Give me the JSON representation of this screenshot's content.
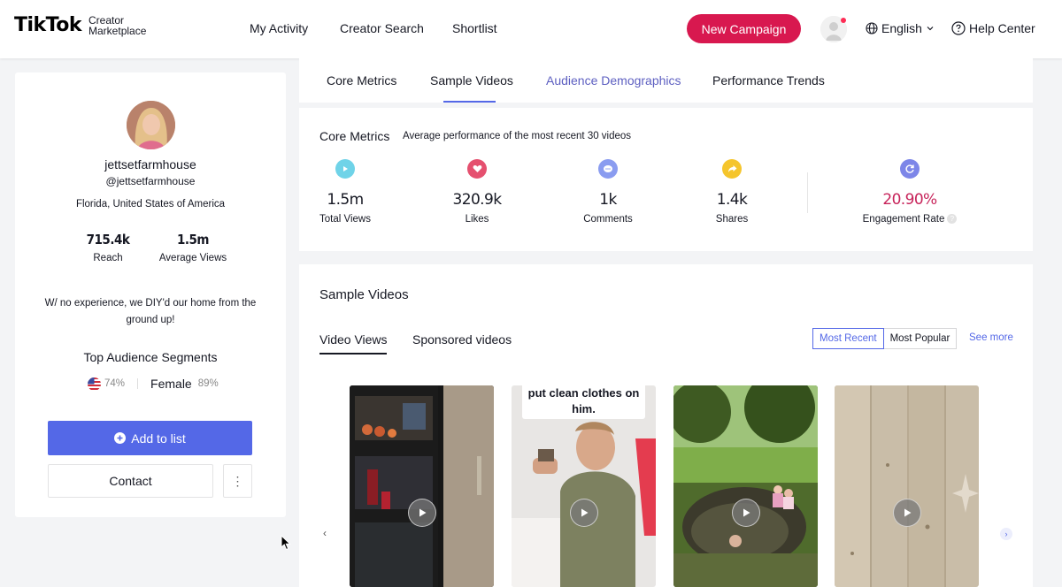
{
  "header": {
    "logo_main": "TikTok",
    "logo_sub_1": "Creator",
    "logo_sub_2": "Marketplace",
    "nav": [
      "My Activity",
      "Creator Search",
      "Shortlist"
    ],
    "new_campaign": "New Campaign",
    "language": "English",
    "help": "Help Center"
  },
  "profile": {
    "username": "jettsetfarmhouse",
    "handle": "@jettsetfarmhouse",
    "location": "Florida, United States of America",
    "reach_value": "715.4k",
    "reach_label": "Reach",
    "avg_views_value": "1.5m",
    "avg_views_label": "Average Views",
    "bio": "W/ no experience, we DIY'd our home from the ground up!",
    "segments_title": "Top Audience Segments",
    "segment_country_pct": "74%",
    "segment_gender": "Female",
    "segment_gender_pct": "89%",
    "add_to_list": "Add to list",
    "contact": "Contact",
    "more": "⋮"
  },
  "tabs": [
    "Core Metrics",
    "Sample Videos",
    "Audience Demographics",
    "Performance Trends"
  ],
  "core_metrics": {
    "title": "Core Metrics",
    "subtitle": "Average performance of the most recent 30 videos",
    "items": [
      {
        "value": "1.5m",
        "label": "Total Views",
        "icon": "play-icon",
        "color": "#6fd3e8"
      },
      {
        "value": "320.9k",
        "label": "Likes",
        "icon": "heart-icon",
        "color": "#e5506f"
      },
      {
        "value": "1k",
        "label": "Comments",
        "icon": "comment-icon",
        "color": "#8a9cf0"
      },
      {
        "value": "1.4k",
        "label": "Shares",
        "icon": "share-icon",
        "color": "#f5c52c"
      },
      {
        "value": "20.90%",
        "label": "Engagement Rate",
        "icon": "refresh-icon",
        "color": "#7d86e8"
      }
    ],
    "engagement_color": "#c7235a"
  },
  "sample_videos": {
    "title": "Sample Videos",
    "tabs": [
      "Video Views",
      "Sponsored videos"
    ],
    "sort_options": [
      "Most Recent",
      "Most Popular"
    ],
    "sort_selected": "Most Recent",
    "see_more": "See more",
    "videos": [
      {
        "caption": ""
      },
      {
        "caption": "put clean clothes on him."
      },
      {
        "caption": ""
      },
      {
        "caption": ""
      }
    ]
  }
}
